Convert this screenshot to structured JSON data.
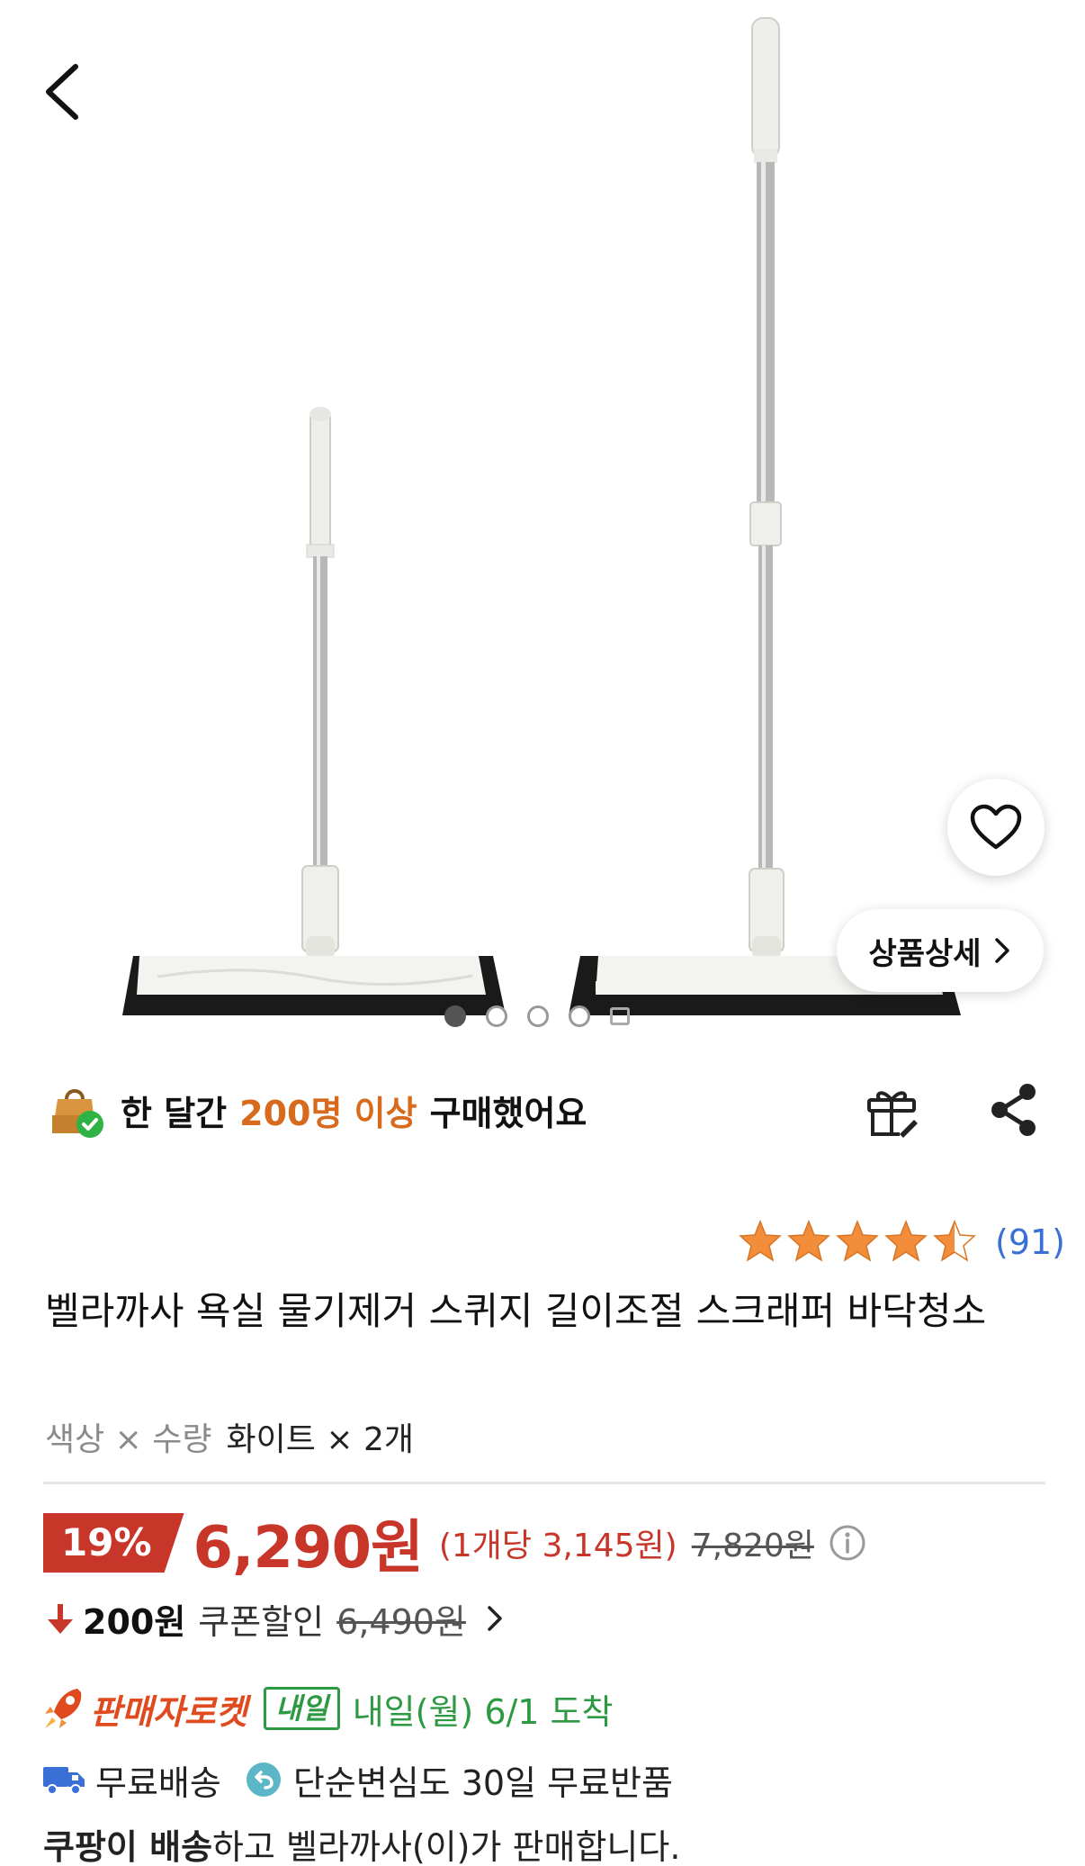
{
  "nav": {
    "back_icon": "chevron-left-icon"
  },
  "gallery": {
    "detail_button_label": "상품상세",
    "dot_count": 4,
    "active_dot": 0
  },
  "social_proof": {
    "prefix": "한 달간",
    "highlight": "200명 이상",
    "suffix": "구매했어요"
  },
  "rating": {
    "stars": 4.5,
    "count_label": "(91)"
  },
  "product": {
    "title": "벨라까사 욕실 물기제거 스퀴지 길이조절 스크래퍼 바닥청소",
    "option_label": "색상 × 수량",
    "option_value": "화이트 × 2개"
  },
  "price": {
    "discount": "19%",
    "sale_price": "6,290원",
    "unit_price": "(1개당 3,145원)",
    "original_price": "7,820원"
  },
  "coupon": {
    "amount": "200원",
    "label": "쿠폰할인",
    "original": "6,490원"
  },
  "delivery": {
    "rocket_label": "판매자로켓",
    "tomorrow_badge": "내일",
    "arrival": "내일(월) 6/1 도착",
    "free_shipping": "무료배송",
    "free_return": "단순변심도 30일 무료반품",
    "seller_bold": "쿠팡이 배송",
    "seller_rest": "하고 벨라까사(이)가 판매합니다."
  },
  "colors": {
    "accent_red": "#c8362a",
    "orange": "#d76a1c",
    "rocket_orange": "#e04a1f",
    "green": "#2d9a43",
    "link_blue": "#3a6fd6",
    "star": "#f28d3c"
  }
}
